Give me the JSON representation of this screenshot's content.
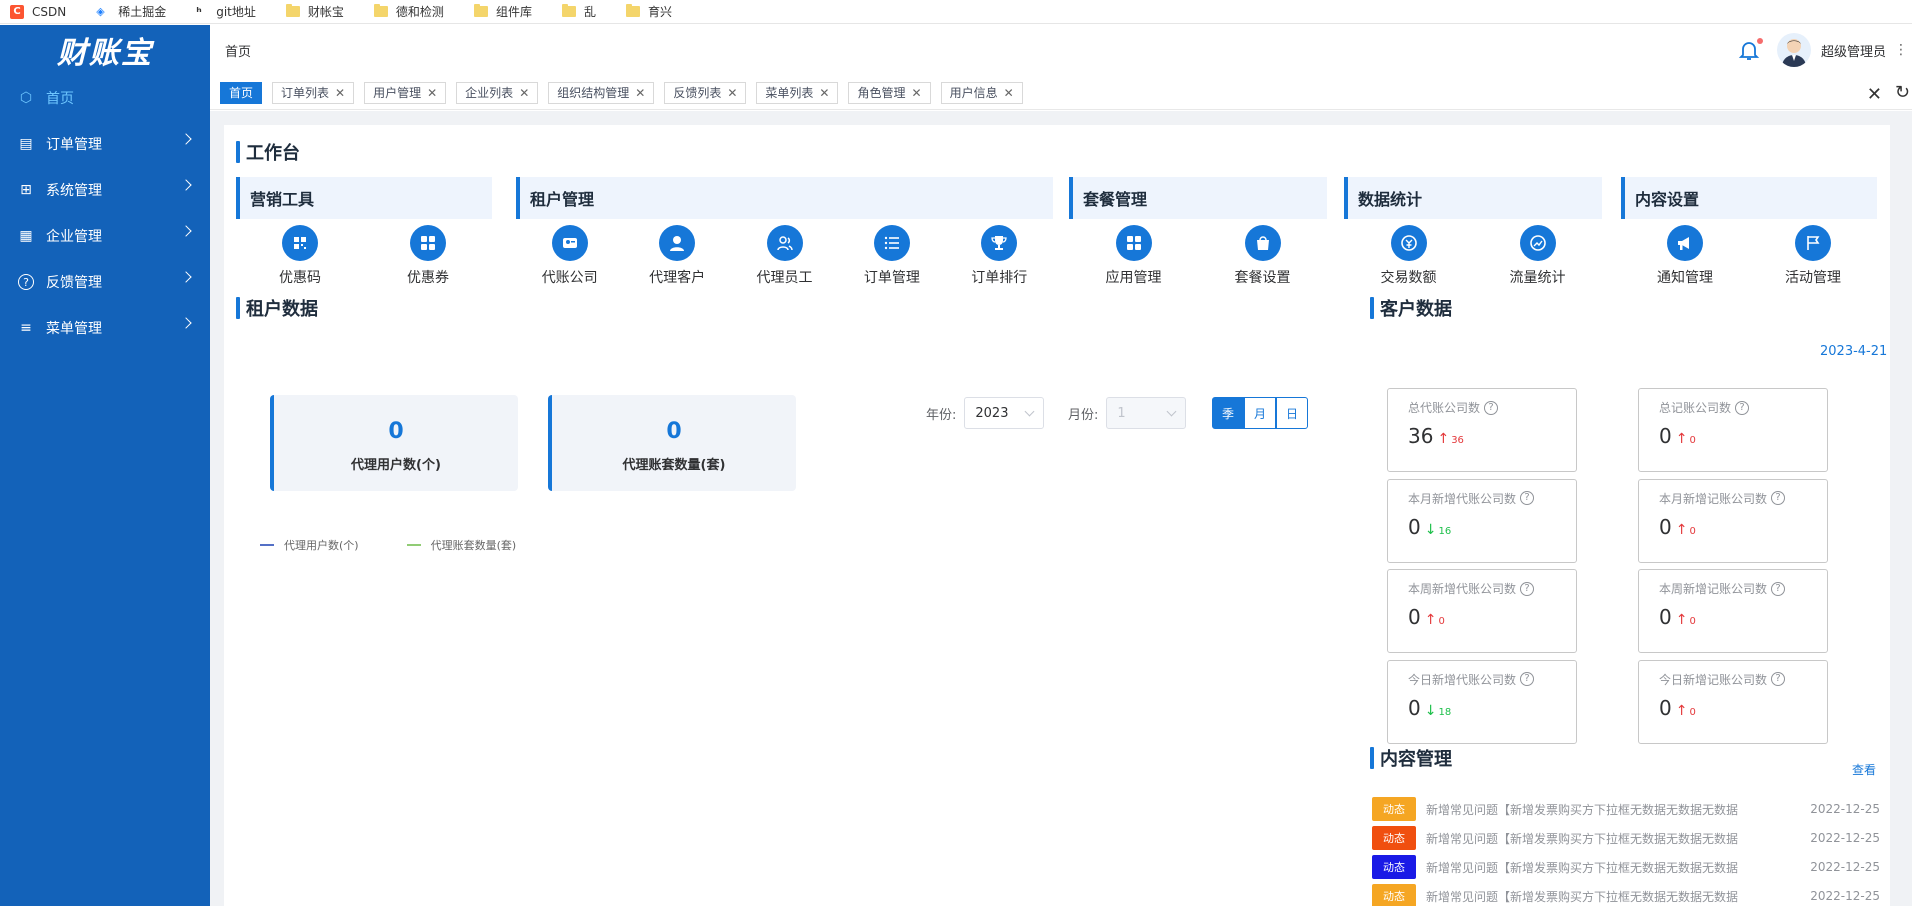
{
  "bookmarks": [
    {
      "icon": "csdn-icon",
      "label": "CSDN"
    },
    {
      "icon": "juejin-icon",
      "label": "稀土掘金"
    },
    {
      "icon": "git-icon",
      "label": "git地址"
    },
    {
      "icon": "folder-icon",
      "label": "财帐宝"
    },
    {
      "icon": "folder-icon",
      "label": "德和检测"
    },
    {
      "icon": "folder-icon",
      "label": "组件库"
    },
    {
      "icon": "folder-icon",
      "label": "乱"
    },
    {
      "icon": "folder-icon",
      "label": "育兴"
    }
  ],
  "sidebar": {
    "logo": "财账宝",
    "items": [
      {
        "label": "首页",
        "icon": "cube-icon",
        "active": true
      },
      {
        "label": "订单管理",
        "icon": "document-icon"
      },
      {
        "label": "系统管理",
        "icon": "grid-icon"
      },
      {
        "label": "企业管理",
        "icon": "building-icon"
      },
      {
        "label": "反馈管理",
        "icon": "question-icon"
      },
      {
        "label": "菜单管理",
        "icon": "menu-icon"
      }
    ]
  },
  "header": {
    "breadcrumb": "首页",
    "user": "超级管理员",
    "more": "⋮"
  },
  "tags": [
    {
      "label": "首页",
      "active": true
    },
    {
      "label": "订单列表"
    },
    {
      "label": "用户管理"
    },
    {
      "label": "企业列表"
    },
    {
      "label": "组织结构管理"
    },
    {
      "label": "反馈列表"
    },
    {
      "label": "菜单列表"
    },
    {
      "label": "角色管理"
    },
    {
      "label": "用户信息"
    }
  ],
  "workbench": {
    "title": "工作台",
    "categories": [
      {
        "label": "营销工具",
        "tools": [
          "优惠码",
          "优惠券"
        ]
      },
      {
        "label": "租户管理",
        "tools": [
          "代账公司",
          "代理客户",
          "代理员工",
          "订单管理",
          "订单排行"
        ]
      },
      {
        "label": "套餐管理",
        "tools": [
          "应用管理",
          "套餐设置"
        ]
      },
      {
        "label": "数据统计",
        "tools": [
          "交易数额",
          "流量统计"
        ]
      },
      {
        "label": "内容设置",
        "tools": [
          "通知管理",
          "活动管理"
        ]
      }
    ]
  },
  "tenant": {
    "title": "租户数据",
    "stats": [
      {
        "value": "0",
        "label": "代理用户数(个)"
      },
      {
        "value": "0",
        "label": "代理账套数量(套)"
      }
    ],
    "filter": {
      "year_label": "年份:",
      "year": "2023",
      "month_label": "月份:",
      "month": "1"
    },
    "segments": [
      {
        "label": "季",
        "on": true
      },
      {
        "label": "月"
      },
      {
        "label": "日"
      }
    ],
    "legend": [
      {
        "label": "代理用户数(个)",
        "color": "#5470c6"
      },
      {
        "label": "代理账套数量(套)",
        "color": "#91cc75"
      }
    ]
  },
  "customer": {
    "title": "客户数据",
    "date": "2023-4-21",
    "kpis": [
      {
        "label": "总代账公司数",
        "value": "36",
        "dir": "up",
        "delta": "36"
      },
      {
        "label": "总记账公司数",
        "value": "0",
        "dir": "up",
        "delta": "0"
      },
      {
        "label": "本月新增代账公司数",
        "value": "0",
        "dir": "down",
        "delta": "16"
      },
      {
        "label": "本月新增记账公司数",
        "value": "0",
        "dir": "up",
        "delta": "0"
      },
      {
        "label": "本周新增代账公司数",
        "value": "0",
        "dir": "up",
        "delta": "0"
      },
      {
        "label": "本周新增记账公司数",
        "value": "0",
        "dir": "up",
        "delta": "0"
      },
      {
        "label": "今日新增代账公司数",
        "value": "0",
        "dir": "down",
        "delta": "18"
      },
      {
        "label": "今日新增记账公司数",
        "value": "0",
        "dir": "up",
        "delta": "0"
      }
    ]
  },
  "content_mgmt": {
    "title": "内容管理",
    "see": "查看",
    "items": [
      {
        "badge": "动态",
        "color": "#f5a623",
        "text": "新增常见问题【新增发票购买方下拉框无数据无数据无数据",
        "date": "2022-12-25"
      },
      {
        "badge": "动态",
        "color": "#f04f0f",
        "text": "新增常见问题【新增发票购买方下拉框无数据无数据无数据",
        "date": "2022-12-25"
      },
      {
        "badge": "动态",
        "color": "#1a1ae6",
        "text": "新增常见问题【新增发票购买方下拉框无数据无数据无数据",
        "date": "2022-12-25"
      },
      {
        "badge": "动态",
        "color": "#f5a623",
        "text": "新增常见问题【新增发票购买方下拉框无数据无数据无数据",
        "date": "2022-12-25"
      }
    ]
  }
}
